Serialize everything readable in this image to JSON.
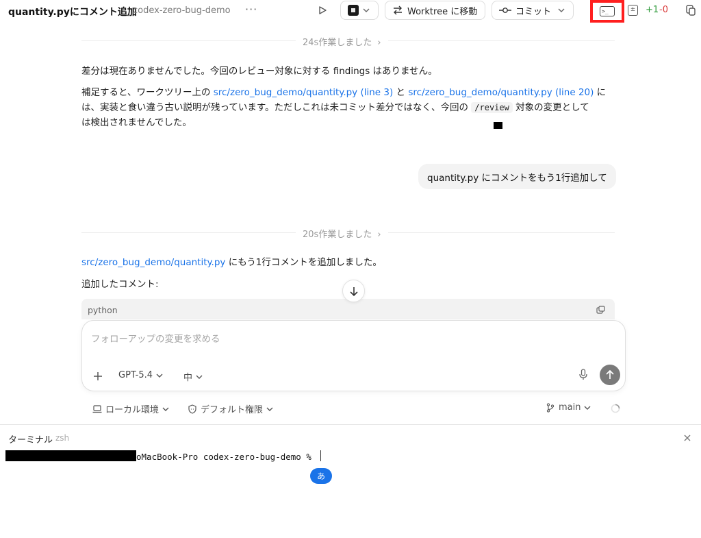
{
  "header": {
    "title": "quantity.pyにコメント追加",
    "project": "codex-zero-bug-demo",
    "more": "···",
    "worktree_label": "Worktree に移動",
    "commit_label": "コミット",
    "diff_added": "+1",
    "diff_removed": "-0",
    "highlight_color": "#ff1f1f"
  },
  "conversation": {
    "work1": "24s作業しました",
    "msg1_line1": "差分は現在ありませんでした。今回のレビュー対象に対する findings はありません。",
    "msg1_p2_a": "補足すると、ワークツリー上の ",
    "msg1_link1": "src/zero_bug_demo/quantity.py (line 3)",
    "msg1_p2_b": " と ",
    "msg1_link2": "src/zero_bug_demo/quantity.py (line 20)",
    "msg1_p2_c": " に",
    "msg1_p2_line2a": "は、実装と食い違う古い説明が残っています。ただしこれは未コミット差分ではなく、今回の ",
    "msg1_code": "/review",
    "msg1_p2_line2b": " 対象の変更として",
    "msg1_p2_line3": "は検出されませんでした。",
    "user_msg": "quantity.py にコメントをもう1行追加して",
    "work2": "20s作業しました",
    "msg2_link": "src/zero_bug_demo/quantity.py",
    "msg2_text": " にもう1行コメントを追加しました。",
    "msg2_label": "追加したコメント:",
    "code_lang": "python"
  },
  "composer": {
    "placeholder": "フォローアップの変更を求める",
    "model": "GPT-5.4",
    "effort": "中"
  },
  "footer": {
    "env": "ローカル環境",
    "permission": "デフォルト権限",
    "branch": "main"
  },
  "terminal": {
    "title": "ターミナル",
    "shell": "zsh",
    "prompt": "oMacBook-Pro codex-zero-bug-demo %",
    "ime": "あ"
  }
}
